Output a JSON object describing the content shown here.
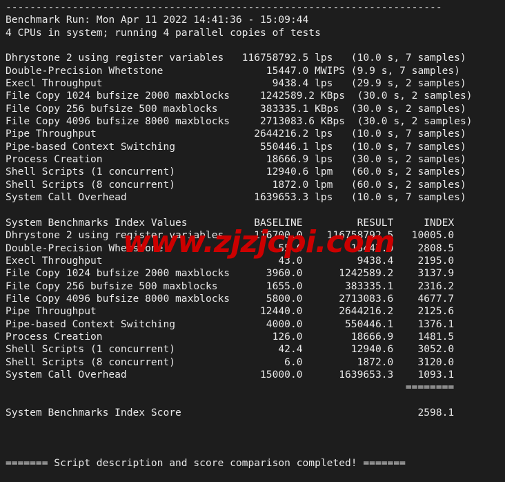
{
  "terminal": {
    "background_color": "#1d1d1d",
    "text_color": "#e8e8e8",
    "top_rule": "------------------------------------------------------------------------",
    "run_header": "Benchmark Run: Mon Apr 11 2022 14:41:36 - 15:09:44",
    "cpu_header": "4 CPUs in system; running 4 parallel copies of tests"
  },
  "watermark": {
    "text": "www.zjzjcpi.com",
    "color": "#cc0000"
  },
  "raw_results": {
    "rows": [
      {
        "name": "Dhrystone 2 using register variables",
        "value": "116758792.5",
        "unit": "lps",
        "timing": "(10.0 s, 7 samples)"
      },
      {
        "name": "Double-Precision Whetstone",
        "value": "15447.0",
        "unit": "MWIPS",
        "timing": "(9.9 s, 7 samples)"
      },
      {
        "name": "Execl Throughput",
        "value": "9438.4",
        "unit": "lps",
        "timing": "(29.9 s, 2 samples)"
      },
      {
        "name": "File Copy 1024 bufsize 2000 maxblocks",
        "value": "1242589.2",
        "unit": "KBps",
        "timing": "(30.0 s, 2 samples)"
      },
      {
        "name": "File Copy 256 bufsize 500 maxblocks",
        "value": "383335.1",
        "unit": "KBps",
        "timing": "(30.0 s, 2 samples)"
      },
      {
        "name": "File Copy 4096 bufsize 8000 maxblocks",
        "value": "2713083.6",
        "unit": "KBps",
        "timing": "(30.0 s, 2 samples)"
      },
      {
        "name": "Pipe Throughput",
        "value": "2644216.2",
        "unit": "lps",
        "timing": "(10.0 s, 7 samples)"
      },
      {
        "name": "Pipe-based Context Switching",
        "value": "550446.1",
        "unit": "lps",
        "timing": "(10.0 s, 7 samples)"
      },
      {
        "name": "Process Creation",
        "value": "18666.9",
        "unit": "lps",
        "timing": "(30.0 s, 2 samples)"
      },
      {
        "name": "Shell Scripts (1 concurrent)",
        "value": "12940.6",
        "unit": "lpm",
        "timing": "(60.0 s, 2 samples)"
      },
      {
        "name": "Shell Scripts (8 concurrent)",
        "value": "1872.0",
        "unit": "lpm",
        "timing": "(60.0 s, 2 samples)"
      },
      {
        "name": "System Call Overhead",
        "value": "1639653.3",
        "unit": "lps",
        "timing": "(10.0 s, 7 samples)"
      }
    ]
  },
  "index_table": {
    "title": "System Benchmarks Index Values",
    "columns": [
      "BASELINE",
      "RESULT",
      "INDEX"
    ],
    "rows": [
      {
        "name": "Dhrystone 2 using register variables",
        "baseline": "116700.0",
        "result": "116758792.5",
        "index": "10005.0"
      },
      {
        "name": "Double-Precision Whetstone",
        "baseline": "55.0",
        "result": "15447.0",
        "index": "2808.5"
      },
      {
        "name": "Execl Throughput",
        "baseline": "43.0",
        "result": "9438.4",
        "index": "2195.0"
      },
      {
        "name": "File Copy 1024 bufsize 2000 maxblocks",
        "baseline": "3960.0",
        "result": "1242589.2",
        "index": "3137.9"
      },
      {
        "name": "File Copy 256 bufsize 500 maxblocks",
        "baseline": "1655.0",
        "result": "383335.1",
        "index": "2316.2"
      },
      {
        "name": "File Copy 4096 bufsize 8000 maxblocks",
        "baseline": "5800.0",
        "result": "2713083.6",
        "index": "4677.7"
      },
      {
        "name": "Pipe Throughput",
        "baseline": "12440.0",
        "result": "2644216.2",
        "index": "2125.6"
      },
      {
        "name": "Pipe-based Context Switching",
        "baseline": "4000.0",
        "result": "550446.1",
        "index": "1376.1"
      },
      {
        "name": "Process Creation",
        "baseline": "126.0",
        "result": "18666.9",
        "index": "1481.5"
      },
      {
        "name": "Shell Scripts (1 concurrent)",
        "baseline": "42.4",
        "result": "12940.6",
        "index": "3052.0"
      },
      {
        "name": "Shell Scripts (8 concurrent)",
        "baseline": "6.0",
        "result": "1872.0",
        "index": "3120.0"
      },
      {
        "name": "System Call Overhead",
        "baseline": "15000.0",
        "result": "1639653.3",
        "index": "1093.1"
      }
    ],
    "separator": "========",
    "score_label": "System Benchmarks Index Score",
    "score_value": "2598.1"
  },
  "footer": {
    "message": "======= Script description and score comparison completed! ======="
  }
}
